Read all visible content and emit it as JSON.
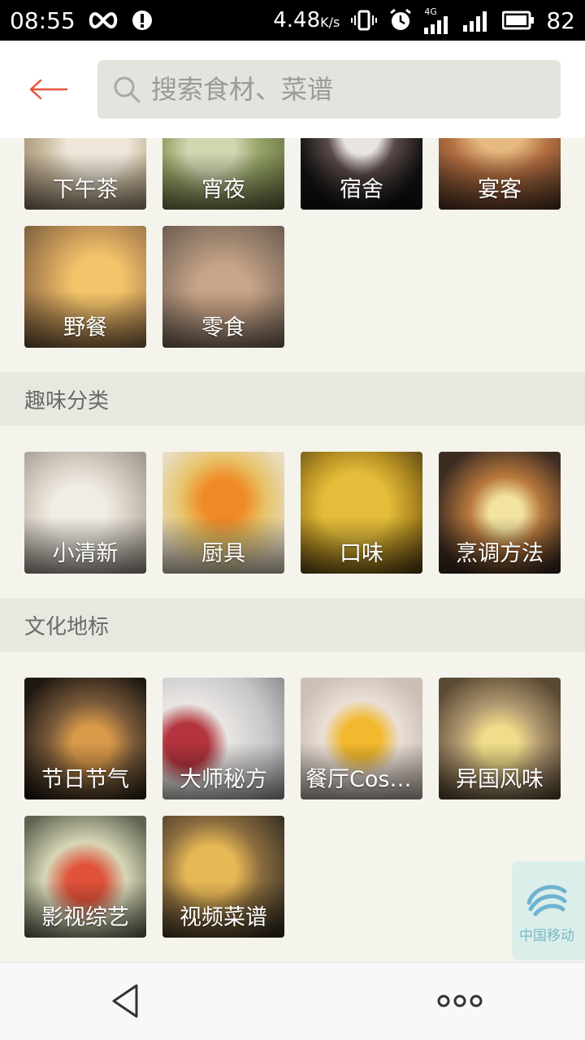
{
  "status_bar": {
    "time": "08:55",
    "speed_value": "4.48",
    "speed_unit": "K/s",
    "network_label": "4G",
    "battery": "82"
  },
  "header": {
    "search_placeholder": "搜索食材、菜谱",
    "accent_color": "#e6553a"
  },
  "scene_tiles_row1": [
    {
      "label": "下午茶"
    },
    {
      "label": "宵夜"
    },
    {
      "label": "宿舍"
    },
    {
      "label": "宴客"
    }
  ],
  "scene_tiles_row2": [
    {
      "label": "野餐"
    },
    {
      "label": "零食"
    }
  ],
  "sections": [
    {
      "title": "趣味分类",
      "tiles": [
        {
          "label": "小清新"
        },
        {
          "label": "厨具"
        },
        {
          "label": "口味"
        },
        {
          "label": "烹调方法"
        }
      ]
    },
    {
      "title": "文化地标",
      "tiles": [
        {
          "label": "节日节气"
        },
        {
          "label": "大师秘方"
        },
        {
          "label": "餐厅Cospl..."
        },
        {
          "label": "异国风味"
        },
        {
          "label": "影视综艺"
        },
        {
          "label": "视频菜谱"
        }
      ]
    }
  ],
  "float_badge": {
    "text": "中国移动"
  },
  "bottom_nav": {
    "back_icon": "triangle-back-icon",
    "more_icon": "three-dots-icon"
  }
}
